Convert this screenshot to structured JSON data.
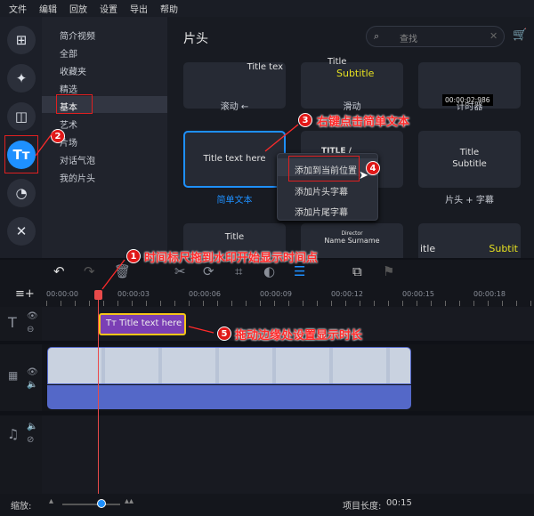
{
  "menu": [
    "文件",
    "编辑",
    "回放",
    "设置",
    "导出",
    "帮助"
  ],
  "sidebar_icons": [
    "import-icon",
    "magic-wand-icon",
    "transition-icon",
    "titles-icon",
    "sticker-icon",
    "tools-icon"
  ],
  "categories": [
    "简介视频",
    "全部",
    "收藏夹",
    "精选",
    "基本",
    "艺术",
    "片场",
    "对话气泡",
    "我的片头"
  ],
  "selected_category": "基本",
  "content": {
    "title": "片头",
    "search_placeholder": "查找",
    "tiles_row1": [
      {
        "preview": "Title tex",
        "label": "滚动 ←"
      },
      {
        "preview": "Title",
        "preview2": "Subtitle",
        "label": "滑动"
      },
      {
        "preview": "00:00:02:986",
        "label": "计时器"
      }
    ],
    "tiles_row2": [
      {
        "preview": "Title text here",
        "label": "简单文本"
      },
      {
        "preview": "TITLE /",
        "label": ""
      },
      {
        "preview": "Title",
        "preview2": "Subtitle",
        "label": "片头 + 字幕"
      }
    ],
    "tiles_row3": [
      {
        "preview": "Title"
      },
      {
        "preview": "Director",
        "preview2": "Name Surname"
      },
      {
        "preview": "itle",
        "preview2": "Subtit"
      }
    ]
  },
  "context_menu": [
    "添加到当前位置",
    "添加片头字幕",
    "添加片尾字幕"
  ],
  "annotations": [
    {
      "num": "1",
      "text": "时间标尺拖到水印开始显示时间点"
    },
    {
      "num": "2",
      "text": ""
    },
    {
      "num": "3",
      "text": "右键点击简单文本"
    },
    {
      "num": "4",
      "text": ""
    },
    {
      "num": "5",
      "text": "拖动边缘处设置显示时长"
    }
  ],
  "ruler": [
    "00:00:00",
    "00:00:03",
    "00:00:06",
    "00:00:09",
    "00:00:12",
    "00:00:15",
    "00:00:18"
  ],
  "title_clip": "Title text here",
  "bottom": {
    "zoom_label": "缩放:",
    "project_length_label": "项目长度:",
    "project_length": "00:15",
    "zoom_level": 0.45
  },
  "colors": {
    "accent": "#1e90ff",
    "clip_purple": "#7b3fb5",
    "clip_border": "#f5c518",
    "video_clip": "#5468c8",
    "playhead": "#e84a4a",
    "annotation": "#ff2a2a"
  }
}
